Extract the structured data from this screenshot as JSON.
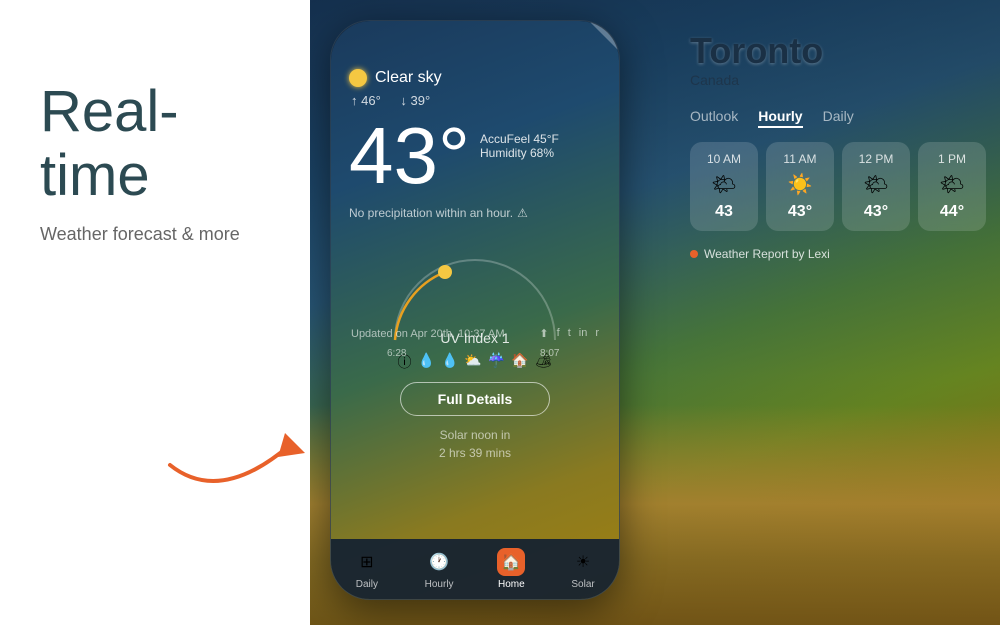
{
  "left_panel": {
    "headline": "Real-time",
    "subheadline": "Weather forecast & more"
  },
  "weather": {
    "condition": "Clear sky",
    "high": "46°",
    "low": "39°",
    "high_label": "↑",
    "low_label": "↓",
    "temperature": "43°",
    "accufeel_label": "AccuFeel 45°F",
    "humidity_label": "Humidity 68%",
    "no_precip": "No precipitation within an hour.",
    "uv_index_label": "UV Index",
    "uv_value": "1",
    "sunrise": "6:28",
    "sunset": "8:07",
    "solar_noon_label": "Solar noon in",
    "solar_noon_time": "2 hrs 39 mins",
    "full_details_btn": "Full Details",
    "updated_label": "Updated on Apr 20th, 10:37 AM"
  },
  "toronto": {
    "city": "Toronto",
    "country": "Canada"
  },
  "outlook_tabs": [
    {
      "label": "Outlook",
      "active": false
    },
    {
      "label": "Hourly",
      "active": true
    },
    {
      "label": "Daily",
      "active": false
    }
  ],
  "hourly_cards": [
    {
      "time": "10 AM",
      "icon": "🌤",
      "temp": "43"
    },
    {
      "time": "11 AM",
      "icon": "☀️",
      "temp": "43°"
    },
    {
      "time": "12 PM",
      "icon": "🌤",
      "temp": "43°"
    },
    {
      "time": "1 PM",
      "icon": "🌤",
      "temp": "44°"
    }
  ],
  "weather_report": "Weather Report by Lexi",
  "tab_bar": [
    {
      "icon": "⊞",
      "label": "Daily",
      "active": false
    },
    {
      "icon": "🕐",
      "label": "Hourly",
      "active": false
    },
    {
      "icon": "🏠",
      "label": "Home",
      "active": true
    },
    {
      "icon": "☀",
      "label": "Solar",
      "active": false
    }
  ],
  "social_icons": [
    "⬆",
    "f",
    "t",
    "in",
    "r"
  ]
}
